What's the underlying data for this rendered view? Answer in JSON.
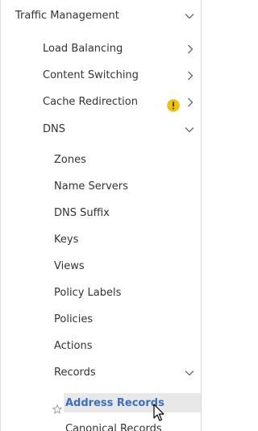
{
  "nav": {
    "section": {
      "label": "Traffic Management",
      "expanded": true
    },
    "items": [
      {
        "label": "Load Balancing",
        "indicator": "chevron-right-icon"
      },
      {
        "label": "Content Switching",
        "indicator": "chevron-right-icon"
      },
      {
        "label": "Cache Redirection",
        "indicator": "chevron-right-icon",
        "badge": "warning-icon"
      },
      {
        "label": "DNS",
        "indicator": "chevron-down-icon"
      }
    ],
    "dns_children": [
      {
        "label": "Zones"
      },
      {
        "label": "Name Servers"
      },
      {
        "label": "DNS Suffix"
      },
      {
        "label": "Keys"
      },
      {
        "label": "Views"
      },
      {
        "label": "Policy Labels"
      },
      {
        "label": "Policies"
      },
      {
        "label": "Actions"
      },
      {
        "label": "Records",
        "indicator": "chevron-down-icon"
      }
    ],
    "records_children": [
      {
        "label": "Address Records",
        "active": true,
        "icon": "star-icon"
      },
      {
        "label": "Canonical Records"
      }
    ]
  },
  "colors": {
    "text": "#333333",
    "active_text": "#3a6fbf",
    "active_bg": "#e8e8e8",
    "warning": "#f2c200",
    "chevron": "#666666",
    "border": "#dcdcdc"
  }
}
